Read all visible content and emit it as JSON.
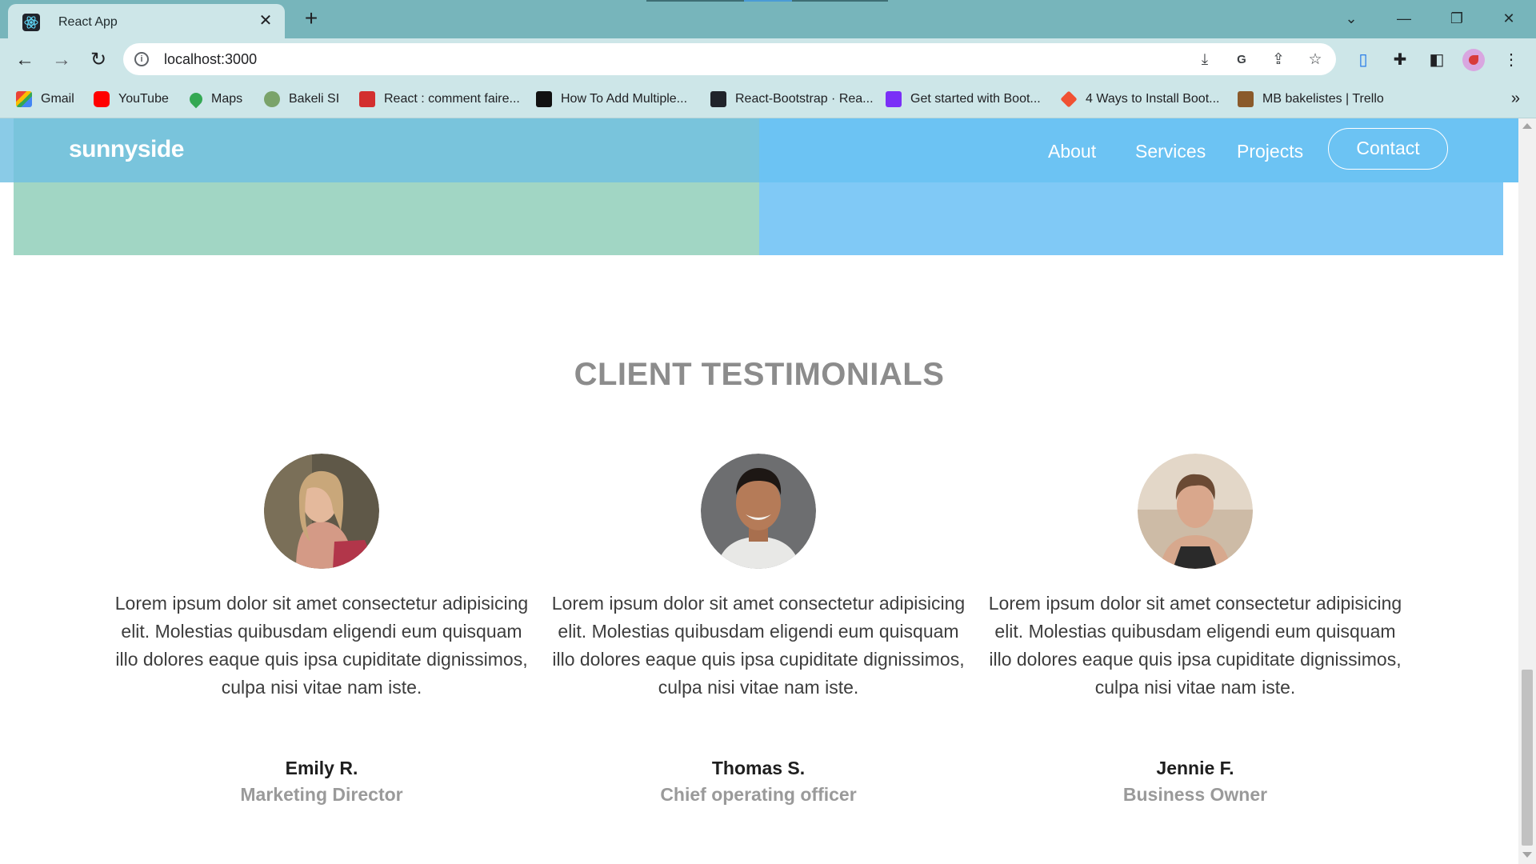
{
  "browser": {
    "tab_title": "React App",
    "url": "localhost:3000",
    "bookmarks": [
      "Gmail",
      "YouTube",
      "Maps",
      "Bakeli SI",
      "React : comment faire...",
      "How To Add Multiple...",
      "React-Bootstrap · Rea...",
      "Get started with Boot...",
      "4 Ways to Install Boot...",
      "MB bakelistes | Trello"
    ]
  },
  "site": {
    "logo": "sunnyside",
    "nav": [
      "About",
      "Services",
      "Projects"
    ],
    "contact": "Contact"
  },
  "testimonials": {
    "title": "CLIENT TESTIMONIALS",
    "items": [
      {
        "quote": "Lorem ipsum dolor sit amet consectetur adipisicing elit. Molestias quibusdam eligendi eum quisquam illo dolores eaque quis ipsa cupiditate dignissimos, culpa nisi vitae nam iste.",
        "name": "Emily R.",
        "role": "Marketing Director"
      },
      {
        "quote": "Lorem ipsum dolor sit amet consectetur adipisicing elit. Molestias quibusdam eligendi eum quisquam illo dolores eaque quis ipsa cupiditate dignissimos, culpa nisi vitae nam iste.",
        "name": "Thomas S.",
        "role": "Chief operating officer"
      },
      {
        "quote": "Lorem ipsum dolor sit amet consectetur adipisicing elit. Molestias quibusdam eligendi eum quisquam illo dolores eaque quis ipsa cupiditate dignissimos, culpa nisi vitae nam iste.",
        "name": "Jennie F.",
        "role": "Business Owner"
      }
    ]
  },
  "colors": {
    "tabstrip": "#77b5bb",
    "toolbar": "#cde6e8",
    "nav_left": "#70c0e2",
    "nav_right": "#6cc3f3",
    "hero_left": "#a1d6c4",
    "hero_right": "#80c9f6",
    "title": "#8c8c8c"
  }
}
